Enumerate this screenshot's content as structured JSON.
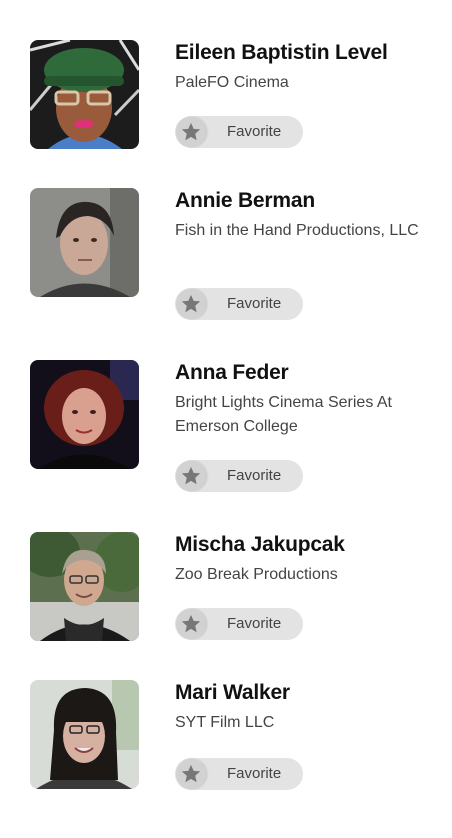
{
  "favorite_label": "Favorite",
  "star_color": "#777777",
  "people": [
    {
      "name": "Eileen Baptistin Level",
      "org": "PaleFO Cinema"
    },
    {
      "name": "Annie Berman",
      "org": "Fish in the Hand Productions, LLC"
    },
    {
      "name": "Anna Feder",
      "org": "Bright Lights Cinema Series At Emerson College"
    },
    {
      "name": "Mischa Jakupcak",
      "org": "Zoo Break Productions"
    },
    {
      "name": "Mari Walker",
      "org": "SYT Film LLC"
    }
  ]
}
